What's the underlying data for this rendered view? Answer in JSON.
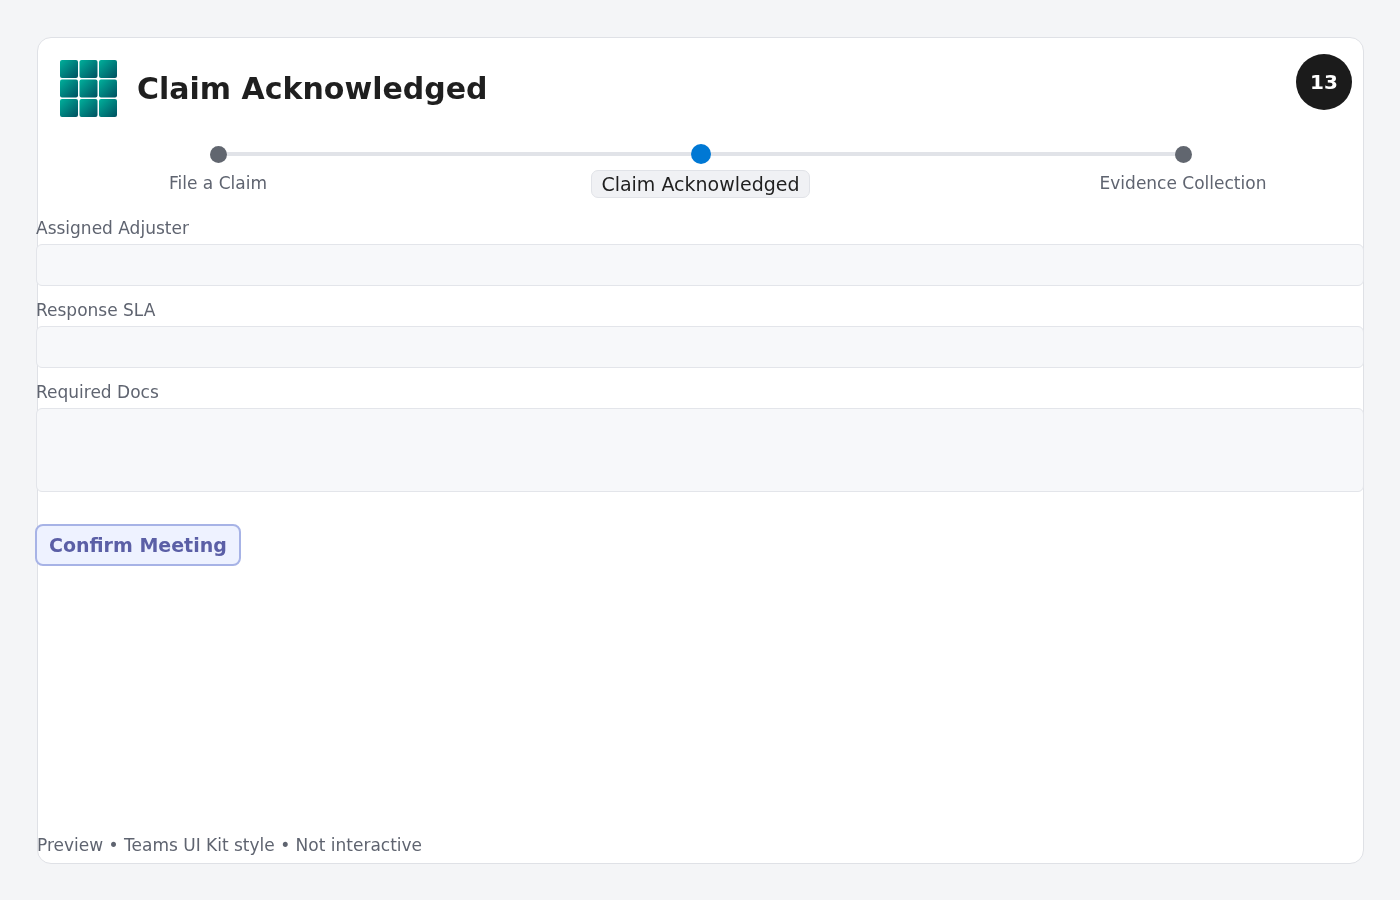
{
  "header": {
    "title": "Claim Acknowledged",
    "badge": "13"
  },
  "steps": [
    {
      "label": "File a Claim",
      "selected": false
    },
    {
      "label": "Claim Acknowledged",
      "selected": true
    },
    {
      "label": "Evidence Collection",
      "selected": false
    }
  ],
  "fields": [
    {
      "label": "Assigned Adjuster",
      "kind": "input"
    },
    {
      "label": "Response SLA",
      "kind": "input"
    },
    {
      "label": "Required Docs",
      "kind": "textarea"
    }
  ],
  "button": "Confirm Meeting",
  "footer": "Preview • Teams UI Kit style • Not interactive"
}
